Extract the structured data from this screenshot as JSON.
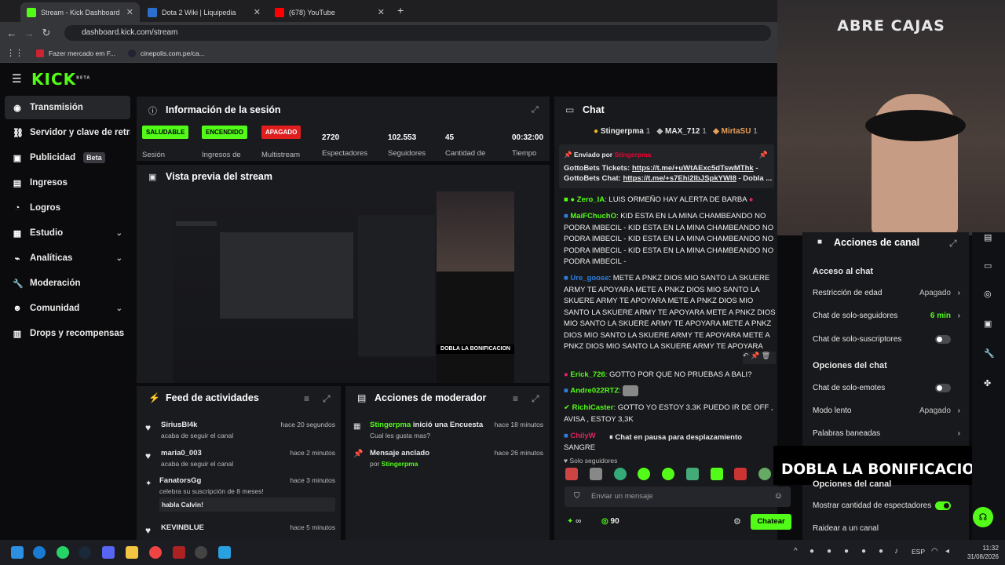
{
  "browser": {
    "tabs": [
      {
        "label": "Stream - Kick Dashboard"
      },
      {
        "label": "Dota 2 Wiki | Liquipedia"
      },
      {
        "label": "(678) YouTube"
      }
    ],
    "url": "dashboard.kick.com/stream",
    "bookmarks": [
      {
        "label": "Fazer mercado em F..."
      },
      {
        "label": "cinepolis.com.pe/ca..."
      }
    ]
  },
  "kick": {
    "logo": "KICK",
    "logo_sup": "BETA"
  },
  "sidebar": {
    "items": [
      {
        "label": "Transmisión",
        "icon": "broadcast-icon"
      },
      {
        "label": "Servidor y clave de retransmisión",
        "icon": "link-icon"
      },
      {
        "label": "Publicidad",
        "badge": "Beta",
        "icon": "ad-icon"
      },
      {
        "label": "Ingresos",
        "icon": "money-icon"
      },
      {
        "label": "Logros",
        "icon": "trophy-icon"
      },
      {
        "label": "Estudio",
        "icon": "studio-icon"
      },
      {
        "label": "Analíticas",
        "icon": "chart-icon"
      },
      {
        "label": "Moderación",
        "icon": "wrench-icon"
      },
      {
        "label": "Comunidad",
        "icon": "people-icon"
      },
      {
        "label": "Drops y recompensas",
        "icon": "gift-icon"
      }
    ]
  },
  "session": {
    "title": "Información de la sesión",
    "stats": [
      {
        "badge": "SALUDABLE",
        "label": "Sesión"
      },
      {
        "badge": "ENCENDIDO",
        "label": "Ingresos de"
      },
      {
        "badge": "APAGADO",
        "label": "Multistream"
      },
      {
        "value": "2720",
        "label": "Espectadores"
      },
      {
        "value": "102.553",
        "label": "Seguidores"
      },
      {
        "value": "45",
        "label": "Cantidad de"
      },
      {
        "value": "00:32:00",
        "label": "Tiempo"
      }
    ]
  },
  "preview": {
    "title": "Vista previa del stream",
    "banner": "DOBLA LA BONIFICACION"
  },
  "activity": {
    "title": "Feed de actividades",
    "items": [
      {
        "user": "SiriusBl4k",
        "text": "acaba de seguir el canal",
        "time": "hace 20 segundos"
      },
      {
        "user": "maria0_003",
        "text": "acaba de seguir el canal",
        "time": "hace 2 minutos"
      },
      {
        "user": "FanatorsGg",
        "text": "celebra su suscripción de 8 meses!",
        "months": "8",
        "time": "hace 3 minutos",
        "message": "habla Calvin!"
      },
      {
        "user": "KEVINBLUE",
        "time": "hace 5 minutos"
      }
    ]
  },
  "modactions": {
    "title": "Acciones de moderador",
    "items": [
      {
        "user": "Stingerpma",
        "action": "inició una Encuesta",
        "sub": "Cual les gusta mas?",
        "time": "hace 18 minutos"
      },
      {
        "action": "Mensaje anclado",
        "by": "por",
        "user": "Stingerpma",
        "time": "hace 26 minutos"
      }
    ]
  },
  "chat": {
    "title": "Chat",
    "top": [
      {
        "name": "Stingerpma"
      },
      {
        "name": "MAX_712"
      },
      {
        "name": "MirtaSU"
      }
    ],
    "pinned": {
      "by": "Enviado por",
      "user": "Stingerpma",
      "line1_label": "GottoBets Tickets:",
      "line1_link": "https://t.me/+uWtAExc5dTswMThk",
      "line1_end": " -",
      "line2_label": "GottoBets Chat:",
      "line2_link": "https://t.me/+s7Ehi2lbJSpkYWI8",
      "line2_end": " - Dobla ..."
    },
    "messages": [
      {
        "user": "Zero_IA",
        "color": "#53fc18",
        "text": "LUIS ORMEÑO HAY ALERTA DE BARBA"
      },
      {
        "user": "MaiFChuchO",
        "color": "#53fc18",
        "text": "KID ESTA EN LA MINA CHAMBEANDO NO PODRA IMBECIL - KID ESTA EN LA MINA CHAMBEANDO NO PODRA IMBECIL - KID ESTA EN LA MINA CHAMBEANDO NO PODRA IMBECIL - KID ESTA EN LA MINA CHAMBEANDO NO PODRA IMBECIL -"
      },
      {
        "user": "Ure_goose",
        "color": "#2f7fe0",
        "text": "METE A PNKZ DIOS MIO SANTO LA SKUERE ARMY TE APOYARA METE A PNKZ DIOS MIO SANTO LA SKUERE ARMY TE APOYARA METE A PNKZ DIOS MIO SANTO LA SKUERE ARMY TE APOYARA METE A PNKZ DIOS MIO SANTO LA SKUERE ARMY TE APOYARA METE A PNKZ DIOS MIO SANTO LA SKUERE ARMY TE APOYARA METE A PNKZ DIOS MIO SANTO LA SKUERE ARMY TE APOYARA"
      },
      {
        "user": "Erick_726",
        "color": "#53fc18",
        "text": "GOTTO POR QUE NO PRUEBAS A BALI?"
      },
      {
        "user": "Andre022RTZ",
        "color": "#53fc18",
        "text": ""
      },
      {
        "user": "RichiCaster",
        "color": "#53fc18",
        "text": "GOTTO YO ESTOY 3.3K PUEDO IR DE OFF , AVISA , ESTOY 3,3K"
      },
      {
        "user": "ChilyW",
        "color": "#e0245e",
        "text": "OTERO DE SANGRE"
      }
    ],
    "paused": "Chat en pausa para desplazamiento",
    "followers_only": "Solo seguidores",
    "placeholder": "Enviar un mensaje",
    "points": "90",
    "send": "Chatear"
  },
  "channel": {
    "title": "Acciones de canal",
    "access_title": "Acceso al chat",
    "rows": [
      {
        "label": "Restricción de edad",
        "value": "Apagado"
      },
      {
        "label": "Chat de solo-seguidores",
        "value": "6 min"
      },
      {
        "label": "Chat de solo-suscriptores"
      }
    ],
    "options_title": "Opciones del chat",
    "rows2": [
      {
        "label": "Chat de solo-emotes"
      },
      {
        "label": "Modo lento",
        "value": "Apagado"
      },
      {
        "label": "Palabras baneadas"
      }
    ],
    "canal_title": "Opciones del canal",
    "rows3": [
      {
        "label": "Mostrar cantidad de espectadores"
      },
      {
        "label": "Raidear a un canal"
      }
    ]
  },
  "overlay": {
    "title": "ABRE CAJAS",
    "banner": "DOBLA LA BONIFICACION"
  },
  "taskbar": {
    "lang": "ESP",
    "time": "11:32",
    "date": "31/08/2026"
  }
}
